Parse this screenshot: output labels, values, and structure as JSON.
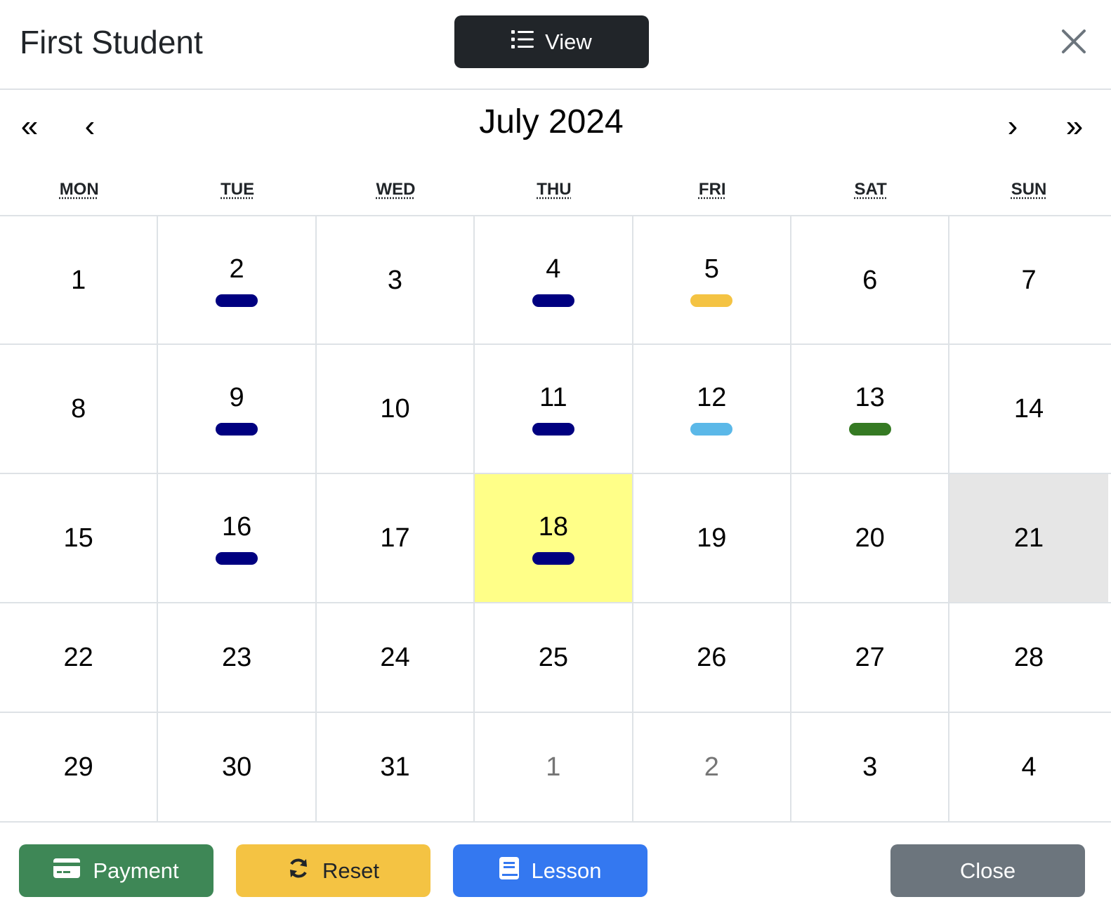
{
  "header": {
    "title": "First Student",
    "view_label": "View"
  },
  "nav": {
    "prev2": "«",
    "prev": "‹",
    "label": "July 2024",
    "next": "›",
    "next2": "»"
  },
  "weekdays": [
    "MON",
    "TUE",
    "WED",
    "THU",
    "FRI",
    "SAT",
    "SUN"
  ],
  "colors": {
    "navy": "#000080",
    "yellow": "#f4c343",
    "lightblue": "#5bb8e8",
    "green": "#357a23",
    "today_bg": "#ffff88",
    "active_bg": "#e6e6e6"
  },
  "weeks": [
    [
      {
        "day": "1"
      },
      {
        "day": "2",
        "dot": "#000080"
      },
      {
        "day": "3"
      },
      {
        "day": "4",
        "dot": "#000080"
      },
      {
        "day": "5",
        "dot": "#f4c343"
      },
      {
        "day": "6"
      },
      {
        "day": "7"
      }
    ],
    [
      {
        "day": "8"
      },
      {
        "day": "9",
        "dot": "#000080"
      },
      {
        "day": "10"
      },
      {
        "day": "11",
        "dot": "#000080"
      },
      {
        "day": "12",
        "dot": "#5bb8e8"
      },
      {
        "day": "13",
        "dot": "#357a23"
      },
      {
        "day": "14"
      }
    ],
    [
      {
        "day": "15"
      },
      {
        "day": "16",
        "dot": "#000080"
      },
      {
        "day": "17"
      },
      {
        "day": "18",
        "dot": "#000080",
        "today": true
      },
      {
        "day": "19"
      },
      {
        "day": "20"
      },
      {
        "day": "21",
        "active": true
      }
    ],
    [
      {
        "day": "22"
      },
      {
        "day": "23"
      },
      {
        "day": "24"
      },
      {
        "day": "25"
      },
      {
        "day": "26"
      },
      {
        "day": "27"
      },
      {
        "day": "28"
      }
    ],
    [
      {
        "day": "29"
      },
      {
        "day": "30"
      },
      {
        "day": "31"
      },
      {
        "day": "1",
        "out": true
      },
      {
        "day": "2",
        "out": true
      },
      {
        "day": "3"
      },
      {
        "day": "4"
      }
    ]
  ],
  "footer": {
    "payment_label": "Payment",
    "reset_label": "Reset",
    "lesson_label": "Lesson",
    "close_label": "Close"
  }
}
